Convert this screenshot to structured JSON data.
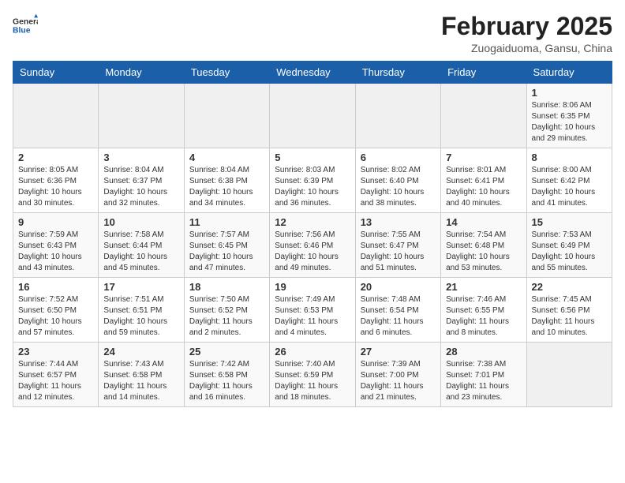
{
  "header": {
    "logo_line1": "General",
    "logo_line2": "Blue",
    "title": "February 2025",
    "subtitle": "Zuogaiduoma, Gansu, China"
  },
  "weekdays": [
    "Sunday",
    "Monday",
    "Tuesday",
    "Wednesday",
    "Thursday",
    "Friday",
    "Saturday"
  ],
  "weeks": [
    [
      {
        "day": "",
        "info": ""
      },
      {
        "day": "",
        "info": ""
      },
      {
        "day": "",
        "info": ""
      },
      {
        "day": "",
        "info": ""
      },
      {
        "day": "",
        "info": ""
      },
      {
        "day": "",
        "info": ""
      },
      {
        "day": "1",
        "info": "Sunrise: 8:06 AM\nSunset: 6:35 PM\nDaylight: 10 hours and 29 minutes."
      }
    ],
    [
      {
        "day": "2",
        "info": "Sunrise: 8:05 AM\nSunset: 6:36 PM\nDaylight: 10 hours and 30 minutes."
      },
      {
        "day": "3",
        "info": "Sunrise: 8:04 AM\nSunset: 6:37 PM\nDaylight: 10 hours and 32 minutes."
      },
      {
        "day": "4",
        "info": "Sunrise: 8:04 AM\nSunset: 6:38 PM\nDaylight: 10 hours and 34 minutes."
      },
      {
        "day": "5",
        "info": "Sunrise: 8:03 AM\nSunset: 6:39 PM\nDaylight: 10 hours and 36 minutes."
      },
      {
        "day": "6",
        "info": "Sunrise: 8:02 AM\nSunset: 6:40 PM\nDaylight: 10 hours and 38 minutes."
      },
      {
        "day": "7",
        "info": "Sunrise: 8:01 AM\nSunset: 6:41 PM\nDaylight: 10 hours and 40 minutes."
      },
      {
        "day": "8",
        "info": "Sunrise: 8:00 AM\nSunset: 6:42 PM\nDaylight: 10 hours and 41 minutes."
      }
    ],
    [
      {
        "day": "9",
        "info": "Sunrise: 7:59 AM\nSunset: 6:43 PM\nDaylight: 10 hours and 43 minutes."
      },
      {
        "day": "10",
        "info": "Sunrise: 7:58 AM\nSunset: 6:44 PM\nDaylight: 10 hours and 45 minutes."
      },
      {
        "day": "11",
        "info": "Sunrise: 7:57 AM\nSunset: 6:45 PM\nDaylight: 10 hours and 47 minutes."
      },
      {
        "day": "12",
        "info": "Sunrise: 7:56 AM\nSunset: 6:46 PM\nDaylight: 10 hours and 49 minutes."
      },
      {
        "day": "13",
        "info": "Sunrise: 7:55 AM\nSunset: 6:47 PM\nDaylight: 10 hours and 51 minutes."
      },
      {
        "day": "14",
        "info": "Sunrise: 7:54 AM\nSunset: 6:48 PM\nDaylight: 10 hours and 53 minutes."
      },
      {
        "day": "15",
        "info": "Sunrise: 7:53 AM\nSunset: 6:49 PM\nDaylight: 10 hours and 55 minutes."
      }
    ],
    [
      {
        "day": "16",
        "info": "Sunrise: 7:52 AM\nSunset: 6:50 PM\nDaylight: 10 hours and 57 minutes."
      },
      {
        "day": "17",
        "info": "Sunrise: 7:51 AM\nSunset: 6:51 PM\nDaylight: 10 hours and 59 minutes."
      },
      {
        "day": "18",
        "info": "Sunrise: 7:50 AM\nSunset: 6:52 PM\nDaylight: 11 hours and 2 minutes."
      },
      {
        "day": "19",
        "info": "Sunrise: 7:49 AM\nSunset: 6:53 PM\nDaylight: 11 hours and 4 minutes."
      },
      {
        "day": "20",
        "info": "Sunrise: 7:48 AM\nSunset: 6:54 PM\nDaylight: 11 hours and 6 minutes."
      },
      {
        "day": "21",
        "info": "Sunrise: 7:46 AM\nSunset: 6:55 PM\nDaylight: 11 hours and 8 minutes."
      },
      {
        "day": "22",
        "info": "Sunrise: 7:45 AM\nSunset: 6:56 PM\nDaylight: 11 hours and 10 minutes."
      }
    ],
    [
      {
        "day": "23",
        "info": "Sunrise: 7:44 AM\nSunset: 6:57 PM\nDaylight: 11 hours and 12 minutes."
      },
      {
        "day": "24",
        "info": "Sunrise: 7:43 AM\nSunset: 6:58 PM\nDaylight: 11 hours and 14 minutes."
      },
      {
        "day": "25",
        "info": "Sunrise: 7:42 AM\nSunset: 6:58 PM\nDaylight: 11 hours and 16 minutes."
      },
      {
        "day": "26",
        "info": "Sunrise: 7:40 AM\nSunset: 6:59 PM\nDaylight: 11 hours and 18 minutes."
      },
      {
        "day": "27",
        "info": "Sunrise: 7:39 AM\nSunset: 7:00 PM\nDaylight: 11 hours and 21 minutes."
      },
      {
        "day": "28",
        "info": "Sunrise: 7:38 AM\nSunset: 7:01 PM\nDaylight: 11 hours and 23 minutes."
      },
      {
        "day": "",
        "info": ""
      }
    ]
  ]
}
